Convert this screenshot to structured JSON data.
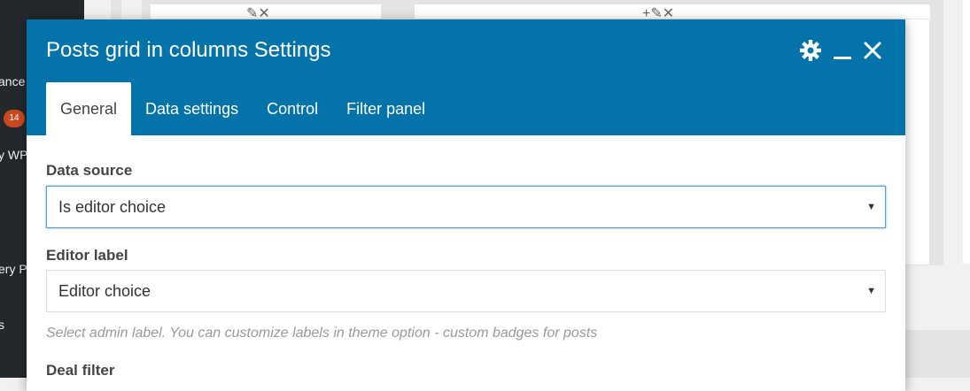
{
  "sidebar": {
    "items": [
      {
        "label": "ance"
      },
      {
        "label": "y WP"
      },
      {
        "label": "ery P"
      },
      {
        "label": "s"
      }
    ],
    "badge": "14"
  },
  "modal": {
    "title": "Posts grid in columns Settings",
    "icons": {
      "settings": "gear-icon",
      "minimize": "minimize-icon",
      "close": "close-icon"
    },
    "tabs": [
      {
        "label": "General",
        "active": true
      },
      {
        "label": "Data settings",
        "active": false
      },
      {
        "label": "Control",
        "active": false
      },
      {
        "label": "Filter panel",
        "active": false
      }
    ],
    "fields": {
      "data_source": {
        "label": "Data source",
        "value": "Is editor choice"
      },
      "editor_label": {
        "label": "Editor label",
        "value": "Editor choice",
        "help": "Select admin label. You can customize labels in theme option - custom badges for posts"
      },
      "deal_filter": {
        "label": "Deal filter"
      }
    }
  },
  "colors": {
    "header": "#0473aa",
    "sidebar": "#23282d",
    "badge": "#ca4a1f"
  }
}
